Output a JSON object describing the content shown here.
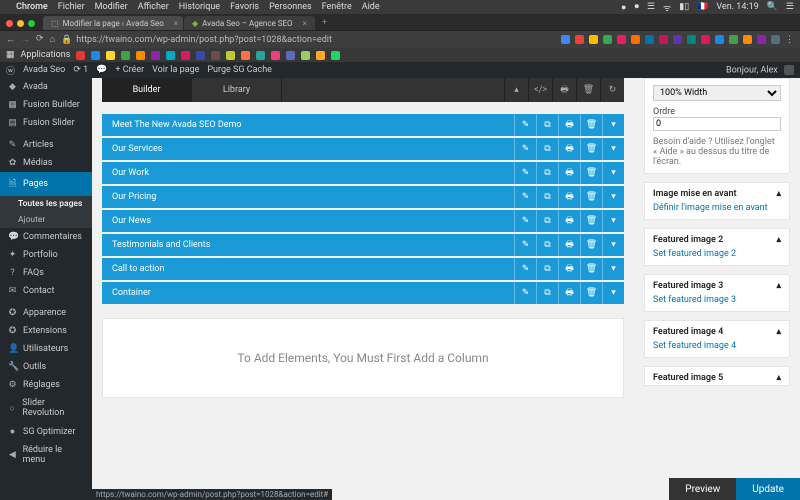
{
  "mac_menu": {
    "app": "Chrome",
    "items": [
      "Fichier",
      "Modifier",
      "Afficher",
      "Historique",
      "Favoris",
      "Personnes",
      "Fenêtre",
      "Aide"
    ],
    "clock": "Ven. 14:19"
  },
  "tabs": [
    {
      "title": "Modifier la page ‹ Avada Seo",
      "active": true
    },
    {
      "title": "Avada Seo – Agence SEO",
      "active": false
    }
  ],
  "url": {
    "lock": "🔒",
    "text": "https://twaino.com/wp-admin/post.php?post=1028&action=edit"
  },
  "bookmarks_label": "Applications",
  "wp_toolbar": {
    "site": "Avada Seo",
    "updates": "1",
    "new": "Créer",
    "view": "Voir la page",
    "purge": "Purge SG Cache",
    "greeting": "Bonjour, Alex"
  },
  "sidebar": [
    {
      "label": "Avada",
      "icon": "◆"
    },
    {
      "label": "Fusion Builder",
      "icon": "▦"
    },
    {
      "label": "Fusion Slider",
      "icon": "▤"
    },
    {
      "label": "Articles",
      "icon": "✎"
    },
    {
      "label": "Médias",
      "icon": "✿"
    },
    {
      "label": "Pages",
      "icon": "🗎",
      "active": true,
      "subs": [
        {
          "label": "Toutes les pages",
          "curr": true
        },
        {
          "label": "Ajouter"
        }
      ]
    },
    {
      "label": "Commentaires",
      "icon": "💬"
    },
    {
      "label": "Portfolio",
      "icon": "✦"
    },
    {
      "label": "FAQs",
      "icon": "?"
    },
    {
      "label": "Contact",
      "icon": "✉"
    },
    {
      "label": "Apparence",
      "icon": "✪"
    },
    {
      "label": "Extensions",
      "icon": "✪"
    },
    {
      "label": "Utilisateurs",
      "icon": "👤"
    },
    {
      "label": "Outils",
      "icon": "🔧"
    },
    {
      "label": "Réglages",
      "icon": "⚙"
    },
    {
      "label": "Slider Revolution",
      "icon": "○"
    },
    {
      "label": "SG Optimizer",
      "icon": "●"
    },
    {
      "label": "Réduire le menu",
      "icon": "◀"
    }
  ],
  "builder": {
    "tabs": [
      {
        "label": "Builder",
        "active": true
      },
      {
        "label": "Library"
      }
    ],
    "tools": [
      "▴",
      "</>",
      "🖶",
      "🗑",
      "↻"
    ],
    "rows": [
      "Meet The New Avada SEO Demo",
      "Our Services",
      "Our Work",
      "Our Pricing",
      "Our News",
      "Testimonials and Clients",
      "Call to action",
      "Container"
    ],
    "row_actions": [
      "✎",
      "⧉",
      "🖶",
      "🗑",
      "▾"
    ],
    "placeholder": "To Add Elements, You Must First Add a Column"
  },
  "panels": {
    "width": {
      "label": "100% Width"
    },
    "order": {
      "label": "Ordre",
      "value": "0"
    },
    "help": "Besoin d'aide ? Utilisez l'onglet « Aide » au dessus du titre de l'écran.",
    "featured": {
      "title": "Image mise en avant",
      "link": "Définir l'image mise en avant"
    },
    "f2": {
      "title": "Featured image 2",
      "link": "Set featured image 2"
    },
    "f3": {
      "title": "Featured image 3",
      "link": "Set featured image 3"
    },
    "f4": {
      "title": "Featured image 4",
      "link": "Set featured image 4"
    },
    "f5": {
      "title": "Featured image 5"
    }
  },
  "footer": {
    "preview": "Preview",
    "update": "Update"
  },
  "statusbar": "https://twaino.com/wp-admin/post.php?post=1028&action=edit#"
}
